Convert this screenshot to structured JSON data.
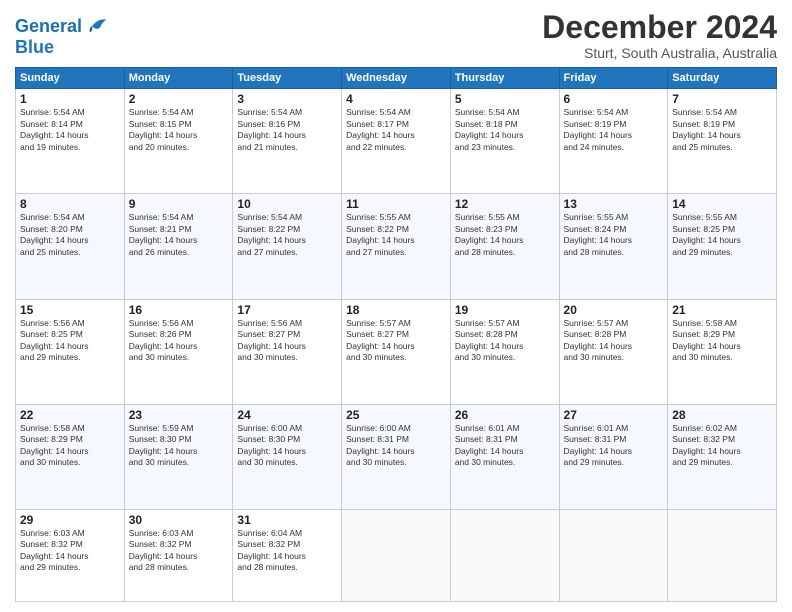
{
  "header": {
    "logo_text1": "General",
    "logo_text2": "Blue",
    "title": "December 2024",
    "subtitle": "Sturt, South Australia, Australia"
  },
  "columns": [
    "Sunday",
    "Monday",
    "Tuesday",
    "Wednesday",
    "Thursday",
    "Friday",
    "Saturday"
  ],
  "weeks": [
    [
      {
        "day": "1",
        "sunrise": "5:54 AM",
        "sunset": "8:14 PM",
        "daylight": "14 hours and 19 minutes."
      },
      {
        "day": "2",
        "sunrise": "5:54 AM",
        "sunset": "8:15 PM",
        "daylight": "14 hours and 20 minutes."
      },
      {
        "day": "3",
        "sunrise": "5:54 AM",
        "sunset": "8:16 PM",
        "daylight": "14 hours and 21 minutes."
      },
      {
        "day": "4",
        "sunrise": "5:54 AM",
        "sunset": "8:17 PM",
        "daylight": "14 hours and 22 minutes."
      },
      {
        "day": "5",
        "sunrise": "5:54 AM",
        "sunset": "8:18 PM",
        "daylight": "14 hours and 23 minutes."
      },
      {
        "day": "6",
        "sunrise": "5:54 AM",
        "sunset": "8:19 PM",
        "daylight": "14 hours and 24 minutes."
      },
      {
        "day": "7",
        "sunrise": "5:54 AM",
        "sunset": "8:19 PM",
        "daylight": "14 hours and 25 minutes."
      }
    ],
    [
      {
        "day": "8",
        "sunrise": "5:54 AM",
        "sunset": "8:20 PM",
        "daylight": "14 hours and 25 minutes."
      },
      {
        "day": "9",
        "sunrise": "5:54 AM",
        "sunset": "8:21 PM",
        "daylight": "14 hours and 26 minutes."
      },
      {
        "day": "10",
        "sunrise": "5:54 AM",
        "sunset": "8:22 PM",
        "daylight": "14 hours and 27 minutes."
      },
      {
        "day": "11",
        "sunrise": "5:55 AM",
        "sunset": "8:22 PM",
        "daylight": "14 hours and 27 minutes."
      },
      {
        "day": "12",
        "sunrise": "5:55 AM",
        "sunset": "8:23 PM",
        "daylight": "14 hours and 28 minutes."
      },
      {
        "day": "13",
        "sunrise": "5:55 AM",
        "sunset": "8:24 PM",
        "daylight": "14 hours and 28 minutes."
      },
      {
        "day": "14",
        "sunrise": "5:55 AM",
        "sunset": "8:25 PM",
        "daylight": "14 hours and 29 minutes."
      }
    ],
    [
      {
        "day": "15",
        "sunrise": "5:56 AM",
        "sunset": "8:25 PM",
        "daylight": "14 hours and 29 minutes."
      },
      {
        "day": "16",
        "sunrise": "5:56 AM",
        "sunset": "8:26 PM",
        "daylight": "14 hours and 30 minutes."
      },
      {
        "day": "17",
        "sunrise": "5:56 AM",
        "sunset": "8:27 PM",
        "daylight": "14 hours and 30 minutes."
      },
      {
        "day": "18",
        "sunrise": "5:57 AM",
        "sunset": "8:27 PM",
        "daylight": "14 hours and 30 minutes."
      },
      {
        "day": "19",
        "sunrise": "5:57 AM",
        "sunset": "8:28 PM",
        "daylight": "14 hours and 30 minutes."
      },
      {
        "day": "20",
        "sunrise": "5:57 AM",
        "sunset": "8:28 PM",
        "daylight": "14 hours and 30 minutes."
      },
      {
        "day": "21",
        "sunrise": "5:58 AM",
        "sunset": "8:29 PM",
        "daylight": "14 hours and 30 minutes."
      }
    ],
    [
      {
        "day": "22",
        "sunrise": "5:58 AM",
        "sunset": "8:29 PM",
        "daylight": "14 hours and 30 minutes."
      },
      {
        "day": "23",
        "sunrise": "5:59 AM",
        "sunset": "8:30 PM",
        "daylight": "14 hours and 30 minutes."
      },
      {
        "day": "24",
        "sunrise": "6:00 AM",
        "sunset": "8:30 PM",
        "daylight": "14 hours and 30 minutes."
      },
      {
        "day": "25",
        "sunrise": "6:00 AM",
        "sunset": "8:31 PM",
        "daylight": "14 hours and 30 minutes."
      },
      {
        "day": "26",
        "sunrise": "6:01 AM",
        "sunset": "8:31 PM",
        "daylight": "14 hours and 30 minutes."
      },
      {
        "day": "27",
        "sunrise": "6:01 AM",
        "sunset": "8:31 PM",
        "daylight": "14 hours and 29 minutes."
      },
      {
        "day": "28",
        "sunrise": "6:02 AM",
        "sunset": "8:32 PM",
        "daylight": "14 hours and 29 minutes."
      }
    ],
    [
      {
        "day": "29",
        "sunrise": "6:03 AM",
        "sunset": "8:32 PM",
        "daylight": "14 hours and 29 minutes."
      },
      {
        "day": "30",
        "sunrise": "6:03 AM",
        "sunset": "8:32 PM",
        "daylight": "14 hours and 28 minutes."
      },
      {
        "day": "31",
        "sunrise": "6:04 AM",
        "sunset": "8:32 PM",
        "daylight": "14 hours and 28 minutes."
      },
      null,
      null,
      null,
      null
    ]
  ],
  "labels": {
    "sunrise": "Sunrise:",
    "sunset": "Sunset:",
    "daylight": "Daylight:"
  }
}
